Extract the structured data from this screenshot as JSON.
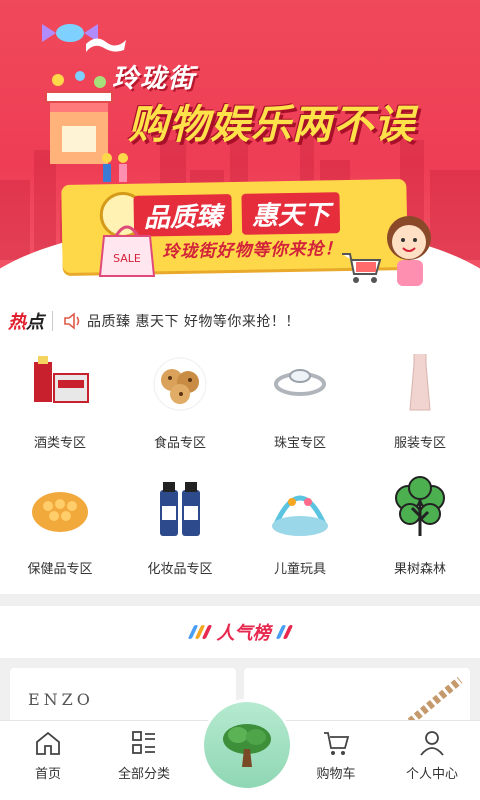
{
  "banner": {
    "brand_small": "玲珑街",
    "brand_big": "购物娱乐两不误",
    "slogan_left": "品质臻",
    "slogan_right": "惠天下",
    "slogan_sub": "玲珑街好物等你来抢！",
    "bag_text": "SALE"
  },
  "news": {
    "hot_red": "热",
    "hot_black": "点",
    "text": "品质臻 惠天下 好物等你来抢！！"
  },
  "categories": [
    {
      "label": "酒类专区",
      "icon": "liquor-icon"
    },
    {
      "label": "食品专区",
      "icon": "cookies-icon"
    },
    {
      "label": "珠宝专区",
      "icon": "ring-icon"
    },
    {
      "label": "服装专区",
      "icon": "dress-icon"
    },
    {
      "label": "保健品专区",
      "icon": "honeycomb-icon"
    },
    {
      "label": "化妆品专区",
      "icon": "cosmetics-icon"
    },
    {
      "label": "儿童玩具",
      "icon": "baby-gym-icon"
    },
    {
      "label": "果树森林",
      "icon": "tree-icon"
    }
  ],
  "popular": {
    "title": "人气榜"
  },
  "products": {
    "p1_brand": "ENZO"
  },
  "tabbar": {
    "home": "首页",
    "categories": "全部分类",
    "cart": "购物车",
    "profile": "个人中心"
  },
  "colors": {
    "brand_red": "#ee3d55",
    "yellow": "#ffd84a",
    "accent_pink": "#e8294f",
    "center_green": "#8fd7b4"
  }
}
